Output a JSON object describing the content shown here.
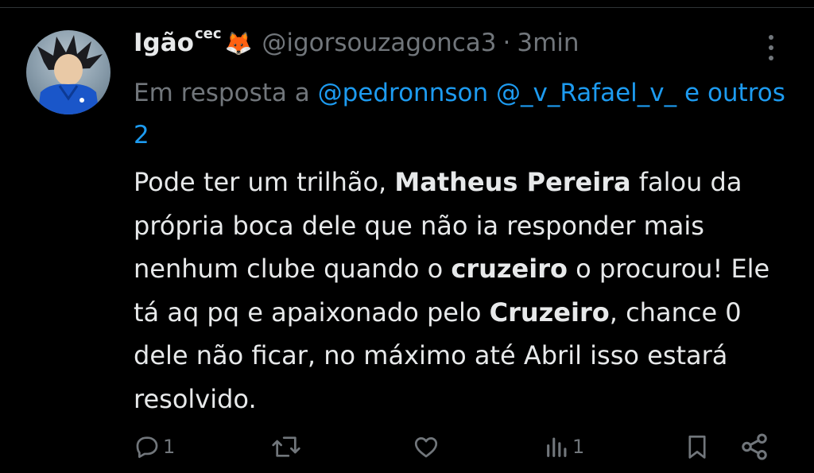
{
  "tweet": {
    "display_name": "Igão",
    "name_sup": "cec",
    "name_emoji": "🦊",
    "handle": "@igorsouzagonca3",
    "separator": "·",
    "time": "3min",
    "reply_prefix": "Em resposta a",
    "reply_mentions": [
      "@pedronnson",
      "@_v_Rafael_v_"
    ],
    "reply_joiner": "e",
    "reply_others": "outros 2",
    "body": {
      "t1": "Pode ter um trilhão, ",
      "b1": "Matheus Pereira",
      "t2": " falou da própria boca dele que não ia responder mais nenhum clube quando o ",
      "b2": "cruzeiro",
      "t3": " o procurou! Ele tá aq pq e apaixonado pelo ",
      "b3": "Cruzeiro",
      "t4": ", chance 0 dele não ficar, no máximo até Abril isso estará resolvido."
    }
  },
  "actions": {
    "reply_count": "1",
    "repost_count": "",
    "like_count": "",
    "views_count": "1"
  },
  "icons": {
    "avatar": "avatar-image",
    "more": "more-dots-icon",
    "reply": "reply-bubble-icon",
    "repost": "repost-icon",
    "like": "heart-icon",
    "views": "views-chart-icon",
    "bookmark": "bookmark-icon",
    "share": "share-icon"
  },
  "colors": {
    "background": "#000000",
    "text": "#e7e9ea",
    "muted": "#71767b",
    "link": "#1d9bf0"
  }
}
